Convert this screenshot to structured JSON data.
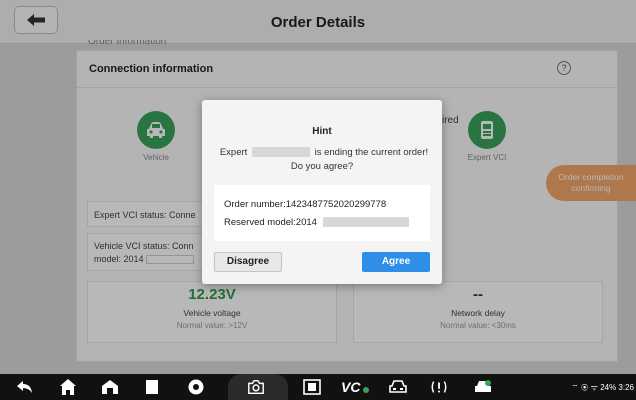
{
  "header": {
    "title": "Order Details",
    "scroll_hint": "Order Information"
  },
  "section": {
    "title": "Connection information",
    "help": "?"
  },
  "nodes": {
    "left_label": "Vehicle",
    "right_label": "Expert VCI",
    "right_partial": "ired"
  },
  "order_button": {
    "line1": "Order completion",
    "line2": "confirming"
  },
  "status": {
    "expert_vci": "Expert VCI status:  Conne",
    "vehicle_vci": "Vehicle VCI status:  Conn",
    "model": "model:  2014"
  },
  "metrics": {
    "voltage": {
      "value": "12.23V",
      "label": "Vehicle voltage",
      "normal": "Normal value: >12V"
    },
    "delay": {
      "value": "--",
      "label": "Network delay",
      "normal": "Normal value: <30ms"
    }
  },
  "dialog": {
    "title": "Hint",
    "msg_prefix": "Expert",
    "msg_suffix": "is ending the current order!",
    "msg_line2": "Do you agree?",
    "order_number": "Order number:1423487752020299778",
    "reserved_model": "Reserved model:2014",
    "disagree_label": "Disagree",
    "agree_label": "Agree"
  },
  "statusbar": {
    "text": "24% 3:26"
  },
  "colors": {
    "accent": "#2f8ee8",
    "node_green": "#3aa35a",
    "order_orange": "#f3a56a"
  }
}
